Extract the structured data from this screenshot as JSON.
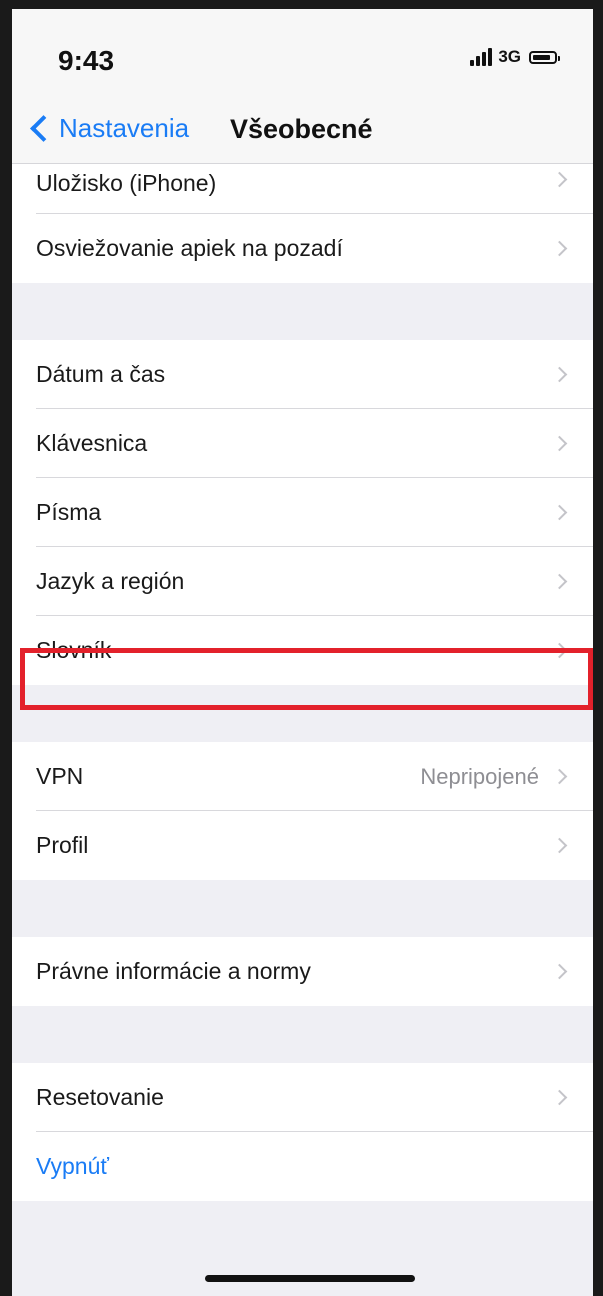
{
  "status_bar": {
    "time": "9:43",
    "network": "3G",
    "icons": [
      "signal-icon",
      "battery-icon"
    ]
  },
  "nav": {
    "back_label": "Nastavenia",
    "title": "Všeobecné"
  },
  "groups": [
    {
      "rows": [
        {
          "label": "Uložisko (iPhone)"
        },
        {
          "label": "Osviežovanie apiek na pozadí"
        }
      ]
    },
    {
      "rows": [
        {
          "label": "Dátum a čas"
        },
        {
          "label": "Klávesnica"
        },
        {
          "label": "Písma"
        },
        {
          "label": "Jazyk a región"
        },
        {
          "label": "Slovník"
        }
      ]
    },
    {
      "rows": [
        {
          "label": "VPN",
          "value": "Nepripojené"
        },
        {
          "label": "Profil"
        }
      ]
    },
    {
      "rows": [
        {
          "label": "Právne informácie a normy"
        }
      ]
    },
    {
      "rows": [
        {
          "label": "Resetovanie"
        },
        {
          "label": "Vypnúť"
        }
      ]
    }
  ],
  "colors": {
    "accent": "#1a7cf5",
    "highlight": "#e3212b"
  }
}
